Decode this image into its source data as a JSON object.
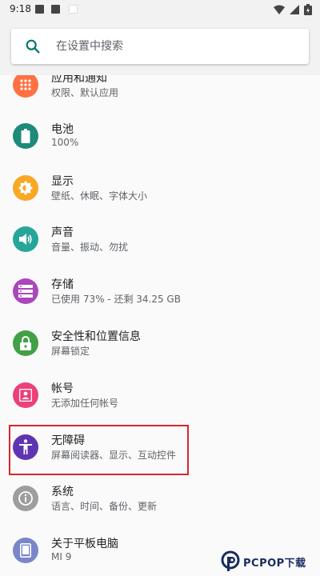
{
  "status_bar": {
    "time": "9:18"
  },
  "search": {
    "placeholder": "在设置中搜索"
  },
  "settings_items": [
    {
      "title": "应用和通知",
      "subtitle": "权限、默认应用",
      "icon": "apps-grid-icon",
      "color": "#ff7043"
    },
    {
      "title": "电池",
      "subtitle": "100%",
      "icon": "battery-icon",
      "color": "#1d8a7a"
    },
    {
      "title": "显示",
      "subtitle": "壁纸、休眠、字体大小",
      "icon": "brightness-icon",
      "color": "#f9a825"
    },
    {
      "title": "声音",
      "subtitle": "音量、振动、勿扰",
      "icon": "volume-icon",
      "color": "#26a69a"
    },
    {
      "title": "存储",
      "subtitle": "已使用 73% - 还剩 34.25 GB",
      "icon": "storage-icon",
      "color": "#ab47bc"
    },
    {
      "title": "安全性和位置信息",
      "subtitle": "屏幕锁定",
      "icon": "lock-icon",
      "color": "#43a047"
    },
    {
      "title": "帐号",
      "subtitle": "无添加任何帐号",
      "icon": "account-icon",
      "color": "#ec407a"
    },
    {
      "title": "无障碍",
      "subtitle": "屏幕阅读器、显示、互动控件",
      "icon": "accessibility-icon",
      "color": "#5e35b1"
    },
    {
      "title": "系统",
      "subtitle": "语言、时间、备份、更新",
      "icon": "info-icon",
      "color": "#9e9e9e"
    },
    {
      "title": "关于平板电脑",
      "subtitle": "MI 9",
      "icon": "tablet-icon",
      "color": "#7986cb"
    }
  ],
  "watermark": {
    "text": "PCPOP下载"
  }
}
